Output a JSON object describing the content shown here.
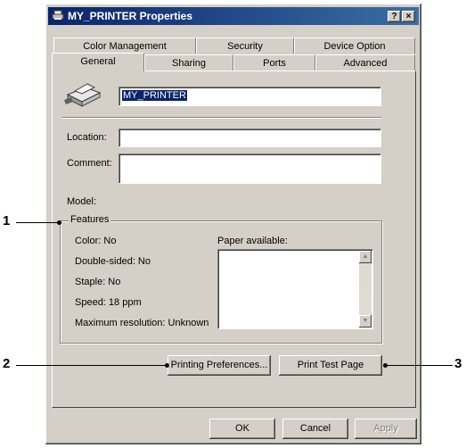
{
  "window": {
    "title": "MY_PRINTER Properties",
    "help_label": "?",
    "close_label": "×"
  },
  "tabs": {
    "row1": [
      "Color Management",
      "Security",
      "Device Option"
    ],
    "row2": [
      "General",
      "Sharing",
      "Ports",
      "Advanced"
    ],
    "active": "General"
  },
  "general": {
    "printer_name": "MY_PRINTER",
    "location_label": "Location:",
    "location_value": "",
    "comment_label": "Comment:",
    "comment_value": "",
    "model_label": "Model:",
    "features": {
      "title": "Features",
      "color": "Color: No",
      "double_sided": "Double-sided: No",
      "staple": "Staple: No",
      "speed": "Speed: 18 ppm",
      "max_resolution": "Maximum resolution: Unknown",
      "paper_label": "Paper available:"
    },
    "printing_prefs_label": "Printing Preferences...",
    "print_test_label": "Print Test Page"
  },
  "footer": {
    "ok_label": "OK",
    "cancel_label": "Cancel",
    "apply_label": "Apply"
  },
  "callouts": [
    "1",
    "2",
    "3"
  ],
  "colors": {
    "titlebar_start": "#0a246a",
    "titlebar_end": "#3a6ea5",
    "dialog_face": "#d4d0c8",
    "selection": "#0a246a"
  }
}
